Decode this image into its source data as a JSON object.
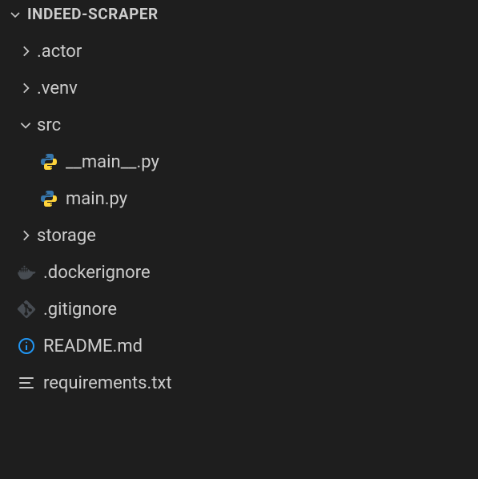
{
  "colors": {
    "background": "#1e1e1e",
    "foreground": "#cccccc",
    "python_icon": "#3776ab",
    "info_icon": "#2196f3",
    "muted_icon": "#8a8a8a",
    "text_icon": "#c5c5c5"
  },
  "root": {
    "name": "INDEED-SCRAPER",
    "expanded": true
  },
  "items": [
    {
      "name": ".actor",
      "type": "folder",
      "expanded": false,
      "depth": 1
    },
    {
      "name": ".venv",
      "type": "folder",
      "expanded": false,
      "depth": 1
    },
    {
      "name": "src",
      "type": "folder",
      "expanded": true,
      "depth": 1
    },
    {
      "name": "__main__.py",
      "type": "python",
      "depth": 2
    },
    {
      "name": "main.py",
      "type": "python",
      "depth": 2
    },
    {
      "name": "storage",
      "type": "folder",
      "expanded": false,
      "depth": 1
    },
    {
      "name": ".dockerignore",
      "type": "docker",
      "depth": 1
    },
    {
      "name": ".gitignore",
      "type": "git",
      "depth": 1
    },
    {
      "name": "README.md",
      "type": "info",
      "depth": 1
    },
    {
      "name": "requirements.txt",
      "type": "text",
      "depth": 1
    }
  ]
}
